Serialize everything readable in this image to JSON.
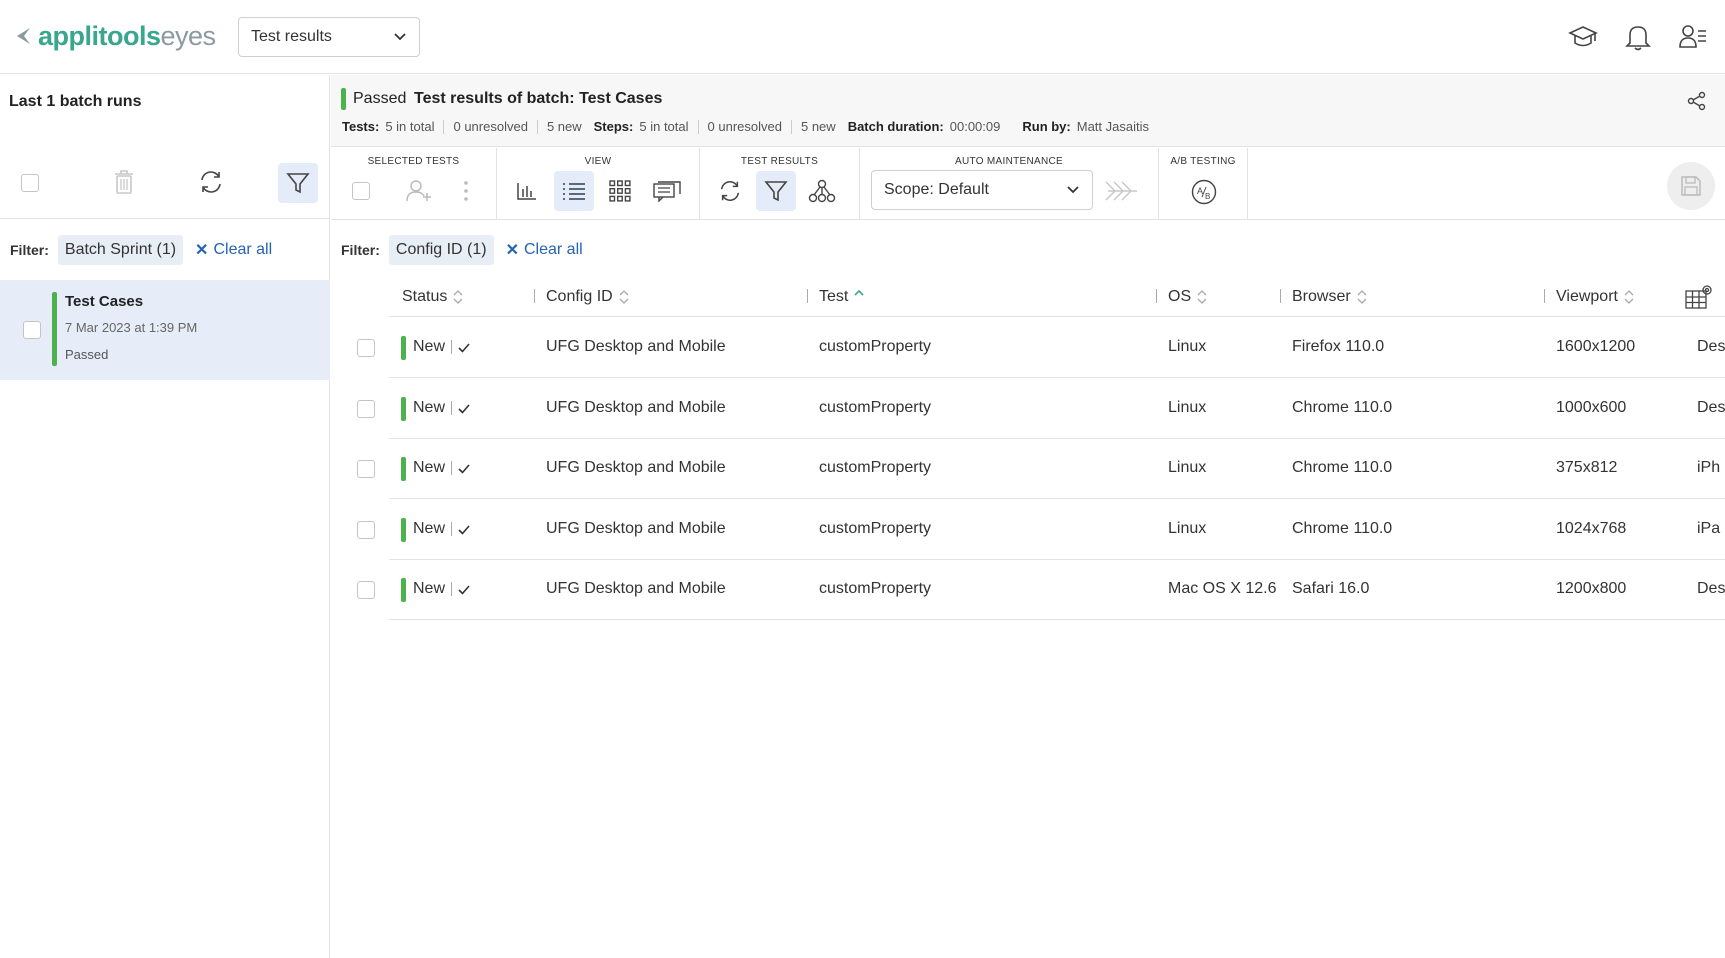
{
  "topbar": {
    "brand_primary": "applitools",
    "brand_secondary": "eyes",
    "page_selector": "Test results",
    "icons": [
      "graduation-cap-icon",
      "bell-icon",
      "user-menu-icon"
    ]
  },
  "left_panel": {
    "title": "Last 1 batch runs",
    "filter_label": "Filter:",
    "filter_chip": "Batch Sprint (1)",
    "clear_all": "Clear all",
    "batch": {
      "name": "Test Cases",
      "date": "7 Mar 2023 at 1:39 PM",
      "status": "Passed"
    }
  },
  "batch_header": {
    "status": "Passed",
    "title": "Test results of batch:  Test Cases",
    "tests_label": "Tests:",
    "tests_total": "5 in total",
    "tests_unresolved": "0 unresolved",
    "tests_new": "5 new",
    "steps_label": "Steps:",
    "steps_total": "5 in total",
    "steps_unresolved": "0 unresolved",
    "steps_new": "5 new",
    "duration_label": "Batch duration:",
    "duration": "00:00:09",
    "run_by_label": "Run by:",
    "run_by": "Matt Jasaitis"
  },
  "toolbar": {
    "selected_tests": "SELECTED TESTS",
    "view": "VIEW",
    "test_results": "TEST RESULTS",
    "auto_maintenance": "AUTO MAINTENANCE",
    "ab_testing": "A/B TESTING",
    "scope": "Scope: Default"
  },
  "filter": {
    "label": "Filter:",
    "chip": "Config ID (1)",
    "clear_all": "Clear all"
  },
  "table": {
    "columns": [
      "Status",
      "Config ID",
      "Test",
      "OS",
      "Browser",
      "Viewport"
    ],
    "rows": [
      {
        "status": "New",
        "config": "UFG Desktop and Mobile",
        "test": "customProperty",
        "os": "Linux",
        "browser": "Firefox 110.0",
        "viewport": "1600x1200",
        "device": "Des"
      },
      {
        "status": "New",
        "config": "UFG Desktop and Mobile",
        "test": "customProperty",
        "os": "Linux",
        "browser": "Chrome 110.0",
        "viewport": "1000x600",
        "device": "Des"
      },
      {
        "status": "New",
        "config": "UFG Desktop and Mobile",
        "test": "customProperty",
        "os": "Linux",
        "browser": "Chrome 110.0",
        "viewport": "375x812",
        "device": "iPh"
      },
      {
        "status": "New",
        "config": "UFG Desktop and Mobile",
        "test": "customProperty",
        "os": "Linux",
        "browser": "Chrome 110.0",
        "viewport": "1024x768",
        "device": "iPa"
      },
      {
        "status": "New",
        "config": "UFG Desktop and Mobile",
        "test": "customProperty",
        "os": "Mac OS X 12.6",
        "browser": "Safari 16.0",
        "viewport": "1200x800",
        "device": "Des"
      }
    ]
  },
  "colors": {
    "brand": "#3aa68f",
    "passed": "#4db24d",
    "link": "#2563b5",
    "selected_bg": "#e6edf8"
  }
}
